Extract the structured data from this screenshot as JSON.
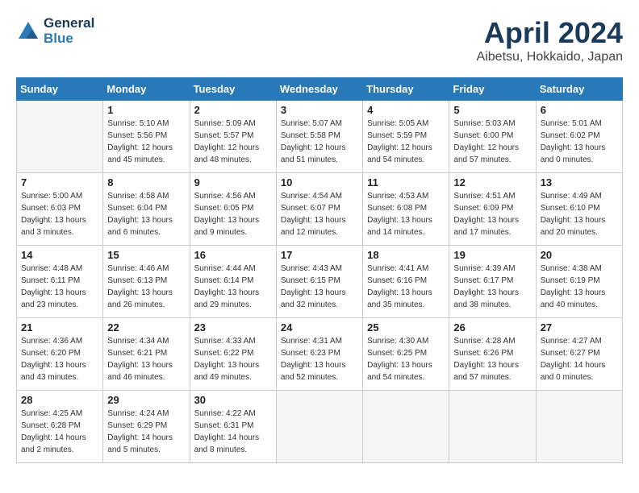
{
  "header": {
    "logo_line1": "General",
    "logo_line2": "Blue",
    "month": "April 2024",
    "location": "Aibetsu, Hokkaido, Japan"
  },
  "weekdays": [
    "Sunday",
    "Monday",
    "Tuesday",
    "Wednesday",
    "Thursday",
    "Friday",
    "Saturday"
  ],
  "weeks": [
    [
      {
        "day": "",
        "sunrise": "",
        "sunset": "",
        "daylight": ""
      },
      {
        "day": "1",
        "sunrise": "Sunrise: 5:10 AM",
        "sunset": "Sunset: 5:56 PM",
        "daylight": "Daylight: 12 hours and 45 minutes."
      },
      {
        "day": "2",
        "sunrise": "Sunrise: 5:09 AM",
        "sunset": "Sunset: 5:57 PM",
        "daylight": "Daylight: 12 hours and 48 minutes."
      },
      {
        "day": "3",
        "sunrise": "Sunrise: 5:07 AM",
        "sunset": "Sunset: 5:58 PM",
        "daylight": "Daylight: 12 hours and 51 minutes."
      },
      {
        "day": "4",
        "sunrise": "Sunrise: 5:05 AM",
        "sunset": "Sunset: 5:59 PM",
        "daylight": "Daylight: 12 hours and 54 minutes."
      },
      {
        "day": "5",
        "sunrise": "Sunrise: 5:03 AM",
        "sunset": "Sunset: 6:00 PM",
        "daylight": "Daylight: 12 hours and 57 minutes."
      },
      {
        "day": "6",
        "sunrise": "Sunrise: 5:01 AM",
        "sunset": "Sunset: 6:02 PM",
        "daylight": "Daylight: 13 hours and 0 minutes."
      }
    ],
    [
      {
        "day": "7",
        "sunrise": "Sunrise: 5:00 AM",
        "sunset": "Sunset: 6:03 PM",
        "daylight": "Daylight: 13 hours and 3 minutes."
      },
      {
        "day": "8",
        "sunrise": "Sunrise: 4:58 AM",
        "sunset": "Sunset: 6:04 PM",
        "daylight": "Daylight: 13 hours and 6 minutes."
      },
      {
        "day": "9",
        "sunrise": "Sunrise: 4:56 AM",
        "sunset": "Sunset: 6:05 PM",
        "daylight": "Daylight: 13 hours and 9 minutes."
      },
      {
        "day": "10",
        "sunrise": "Sunrise: 4:54 AM",
        "sunset": "Sunset: 6:07 PM",
        "daylight": "Daylight: 13 hours and 12 minutes."
      },
      {
        "day": "11",
        "sunrise": "Sunrise: 4:53 AM",
        "sunset": "Sunset: 6:08 PM",
        "daylight": "Daylight: 13 hours and 14 minutes."
      },
      {
        "day": "12",
        "sunrise": "Sunrise: 4:51 AM",
        "sunset": "Sunset: 6:09 PM",
        "daylight": "Daylight: 13 hours and 17 minutes."
      },
      {
        "day": "13",
        "sunrise": "Sunrise: 4:49 AM",
        "sunset": "Sunset: 6:10 PM",
        "daylight": "Daylight: 13 hours and 20 minutes."
      }
    ],
    [
      {
        "day": "14",
        "sunrise": "Sunrise: 4:48 AM",
        "sunset": "Sunset: 6:11 PM",
        "daylight": "Daylight: 13 hours and 23 minutes."
      },
      {
        "day": "15",
        "sunrise": "Sunrise: 4:46 AM",
        "sunset": "Sunset: 6:13 PM",
        "daylight": "Daylight: 13 hours and 26 minutes."
      },
      {
        "day": "16",
        "sunrise": "Sunrise: 4:44 AM",
        "sunset": "Sunset: 6:14 PM",
        "daylight": "Daylight: 13 hours and 29 minutes."
      },
      {
        "day": "17",
        "sunrise": "Sunrise: 4:43 AM",
        "sunset": "Sunset: 6:15 PM",
        "daylight": "Daylight: 13 hours and 32 minutes."
      },
      {
        "day": "18",
        "sunrise": "Sunrise: 4:41 AM",
        "sunset": "Sunset: 6:16 PM",
        "daylight": "Daylight: 13 hours and 35 minutes."
      },
      {
        "day": "19",
        "sunrise": "Sunrise: 4:39 AM",
        "sunset": "Sunset: 6:17 PM",
        "daylight": "Daylight: 13 hours and 38 minutes."
      },
      {
        "day": "20",
        "sunrise": "Sunrise: 4:38 AM",
        "sunset": "Sunset: 6:19 PM",
        "daylight": "Daylight: 13 hours and 40 minutes."
      }
    ],
    [
      {
        "day": "21",
        "sunrise": "Sunrise: 4:36 AM",
        "sunset": "Sunset: 6:20 PM",
        "daylight": "Daylight: 13 hours and 43 minutes."
      },
      {
        "day": "22",
        "sunrise": "Sunrise: 4:34 AM",
        "sunset": "Sunset: 6:21 PM",
        "daylight": "Daylight: 13 hours and 46 minutes."
      },
      {
        "day": "23",
        "sunrise": "Sunrise: 4:33 AM",
        "sunset": "Sunset: 6:22 PM",
        "daylight": "Daylight: 13 hours and 49 minutes."
      },
      {
        "day": "24",
        "sunrise": "Sunrise: 4:31 AM",
        "sunset": "Sunset: 6:23 PM",
        "daylight": "Daylight: 13 hours and 52 minutes."
      },
      {
        "day": "25",
        "sunrise": "Sunrise: 4:30 AM",
        "sunset": "Sunset: 6:25 PM",
        "daylight": "Daylight: 13 hours and 54 minutes."
      },
      {
        "day": "26",
        "sunrise": "Sunrise: 4:28 AM",
        "sunset": "Sunset: 6:26 PM",
        "daylight": "Daylight: 13 hours and 57 minutes."
      },
      {
        "day": "27",
        "sunrise": "Sunrise: 4:27 AM",
        "sunset": "Sunset: 6:27 PM",
        "daylight": "Daylight: 14 hours and 0 minutes."
      }
    ],
    [
      {
        "day": "28",
        "sunrise": "Sunrise: 4:25 AM",
        "sunset": "Sunset: 6:28 PM",
        "daylight": "Daylight: 14 hours and 2 minutes."
      },
      {
        "day": "29",
        "sunrise": "Sunrise: 4:24 AM",
        "sunset": "Sunset: 6:29 PM",
        "daylight": "Daylight: 14 hours and 5 minutes."
      },
      {
        "day": "30",
        "sunrise": "Sunrise: 4:22 AM",
        "sunset": "Sunset: 6:31 PM",
        "daylight": "Daylight: 14 hours and 8 minutes."
      },
      {
        "day": "",
        "sunrise": "",
        "sunset": "",
        "daylight": ""
      },
      {
        "day": "",
        "sunrise": "",
        "sunset": "",
        "daylight": ""
      },
      {
        "day": "",
        "sunrise": "",
        "sunset": "",
        "daylight": ""
      },
      {
        "day": "",
        "sunrise": "",
        "sunset": "",
        "daylight": ""
      }
    ]
  ]
}
